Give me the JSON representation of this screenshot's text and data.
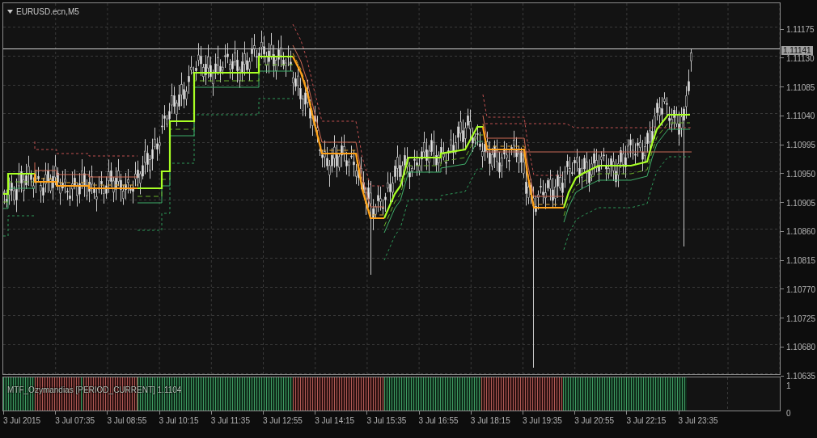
{
  "window": {
    "title": "EURUSD.ecn,M5"
  },
  "price_axis": {
    "labels": [
      "1.11175",
      "1.11130",
      "1.11085",
      "1.11040",
      "1.10995",
      "1.10950",
      "1.10905",
      "1.10860",
      "1.10815",
      "1.10770",
      "1.10725",
      "1.10680",
      "1.10635"
    ],
    "current_price": "1.11141"
  },
  "indicator": {
    "label": "MTF_Ozymandias [PERIOD_CURRENT] 1.1104",
    "axis_labels": [
      "1",
      "0"
    ]
  },
  "time_axis": {
    "labels": [
      "3 Jul 2015",
      "3 Jul 07:35",
      "3 Jul 08:55",
      "3 Jul 10:15",
      "3 Jul 11:35",
      "3 Jul 12:55",
      "3 Jul 14:15",
      "3 Jul 15:35",
      "3 Jul 16:55",
      "3 Jul 18:15",
      "3 Jul 19:35",
      "3 Jul 20:55",
      "3 Jul 22:15",
      "3 Jul 23:35"
    ]
  }
}
